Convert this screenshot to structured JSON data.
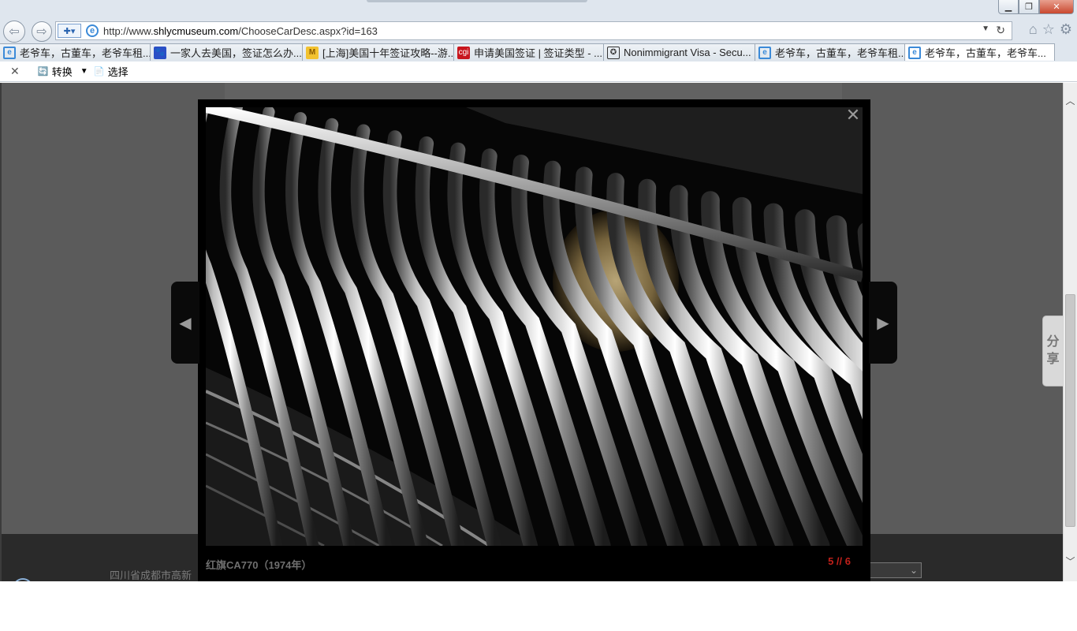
{
  "browser": {
    "address": {
      "url_prefix": "http://www.",
      "url_domain": "shlycmuseum.com",
      "url_path": "/ChooseCarDesc.aspx?id=163"
    },
    "tabs": [
      {
        "label": "老爷车，古董车，老爷车租...",
        "icon": "ie-icon"
      },
      {
        "label": "一家人去美国，签证怎么办...",
        "icon": "baidu-paw-icon"
      },
      {
        "label": "[上海]美国十年签证攻略--游...",
        "icon": "mafengwo-icon"
      },
      {
        "label": "申请美国签证 | 签证类型 - ...",
        "icon": "cgi-icon"
      },
      {
        "label": "Nonimmigrant Visa - Secu...",
        "icon": "us-seal-icon"
      },
      {
        "label": "老爷车，古董车，老爷车租...",
        "icon": "ie-icon"
      },
      {
        "label": "老爷车，古董车，老爷车...",
        "icon": "ie-icon",
        "active": true
      }
    ],
    "command_bar": {
      "convert_label": "转换",
      "select_label": "选择"
    }
  },
  "lightbox": {
    "caption": "红旗CA770（1974年）",
    "counter": "5 // 6",
    "counter_color": "#c0201a"
  },
  "share": {
    "label_line1": "分",
    "label_line2": "享"
  },
  "footer": {
    "address_text": "四川省成都市高新"
  }
}
